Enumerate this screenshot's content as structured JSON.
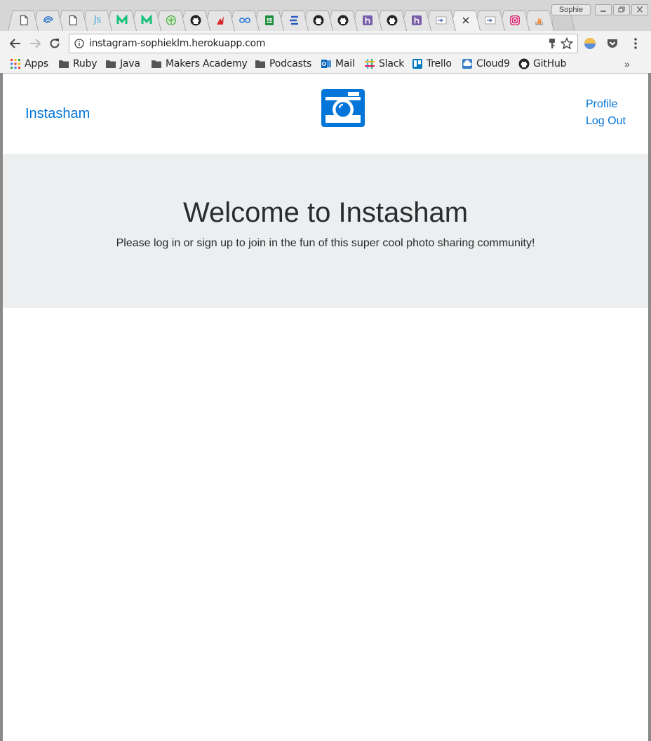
{
  "browser": {
    "profile_name": "Sophie",
    "url": "instagram-sophieklm.herokuapp.com",
    "tabs": [
      {
        "icon": "blank-page-icon"
      },
      {
        "icon": "spiral-icon"
      },
      {
        "icon": "blank-page-icon"
      },
      {
        "icon": "js-icon",
        "text": "Js"
      },
      {
        "icon": "medium-icon"
      },
      {
        "icon": "medium-icon"
      },
      {
        "icon": "leaf-icon"
      },
      {
        "icon": "github-icon"
      },
      {
        "icon": "red-logo-icon"
      },
      {
        "icon": "infinity-icon"
      },
      {
        "icon": "sheets-icon"
      },
      {
        "icon": "e-logo-icon"
      },
      {
        "icon": "github-icon"
      },
      {
        "icon": "github-icon"
      },
      {
        "icon": "heroku-icon"
      },
      {
        "icon": "github-icon"
      },
      {
        "icon": "heroku-icon"
      },
      {
        "icon": "page-preview-icon"
      },
      {
        "icon": "close-icon",
        "active": true
      },
      {
        "icon": "page-preview-icon"
      },
      {
        "icon": "instagram-icon"
      },
      {
        "icon": "stackoverflow-icon"
      }
    ],
    "bookmarks": [
      {
        "label": "Apps",
        "icon": "apps-grid-icon"
      },
      {
        "label": "Ruby",
        "icon": "folder-icon"
      },
      {
        "label": "Java",
        "icon": "folder-icon"
      },
      {
        "label": "Makers Academy",
        "icon": "folder-icon"
      },
      {
        "label": "Podcasts",
        "icon": "folder-icon"
      },
      {
        "label": "Mail",
        "icon": "outlook-icon"
      },
      {
        "label": "Slack",
        "icon": "slack-icon"
      },
      {
        "label": "Trello",
        "icon": "trello-icon"
      },
      {
        "label": "Cloud9",
        "icon": "cloud9-icon"
      },
      {
        "label": "GitHub",
        "icon": "github-icon"
      }
    ],
    "bookmarks_overflow": "»"
  },
  "page": {
    "brand": "Instasham",
    "nav": {
      "profile": "Profile",
      "logout": "Log Out"
    },
    "hero": {
      "title": "Welcome to Instasham",
      "subtitle": "Please log in or sign up to join in the fun of this super cool photo sharing community!"
    }
  },
  "colors": {
    "link": "#0275d8",
    "logo": "#0275d8",
    "hero_bg": "#eceeef",
    "text": "#292b2c"
  }
}
